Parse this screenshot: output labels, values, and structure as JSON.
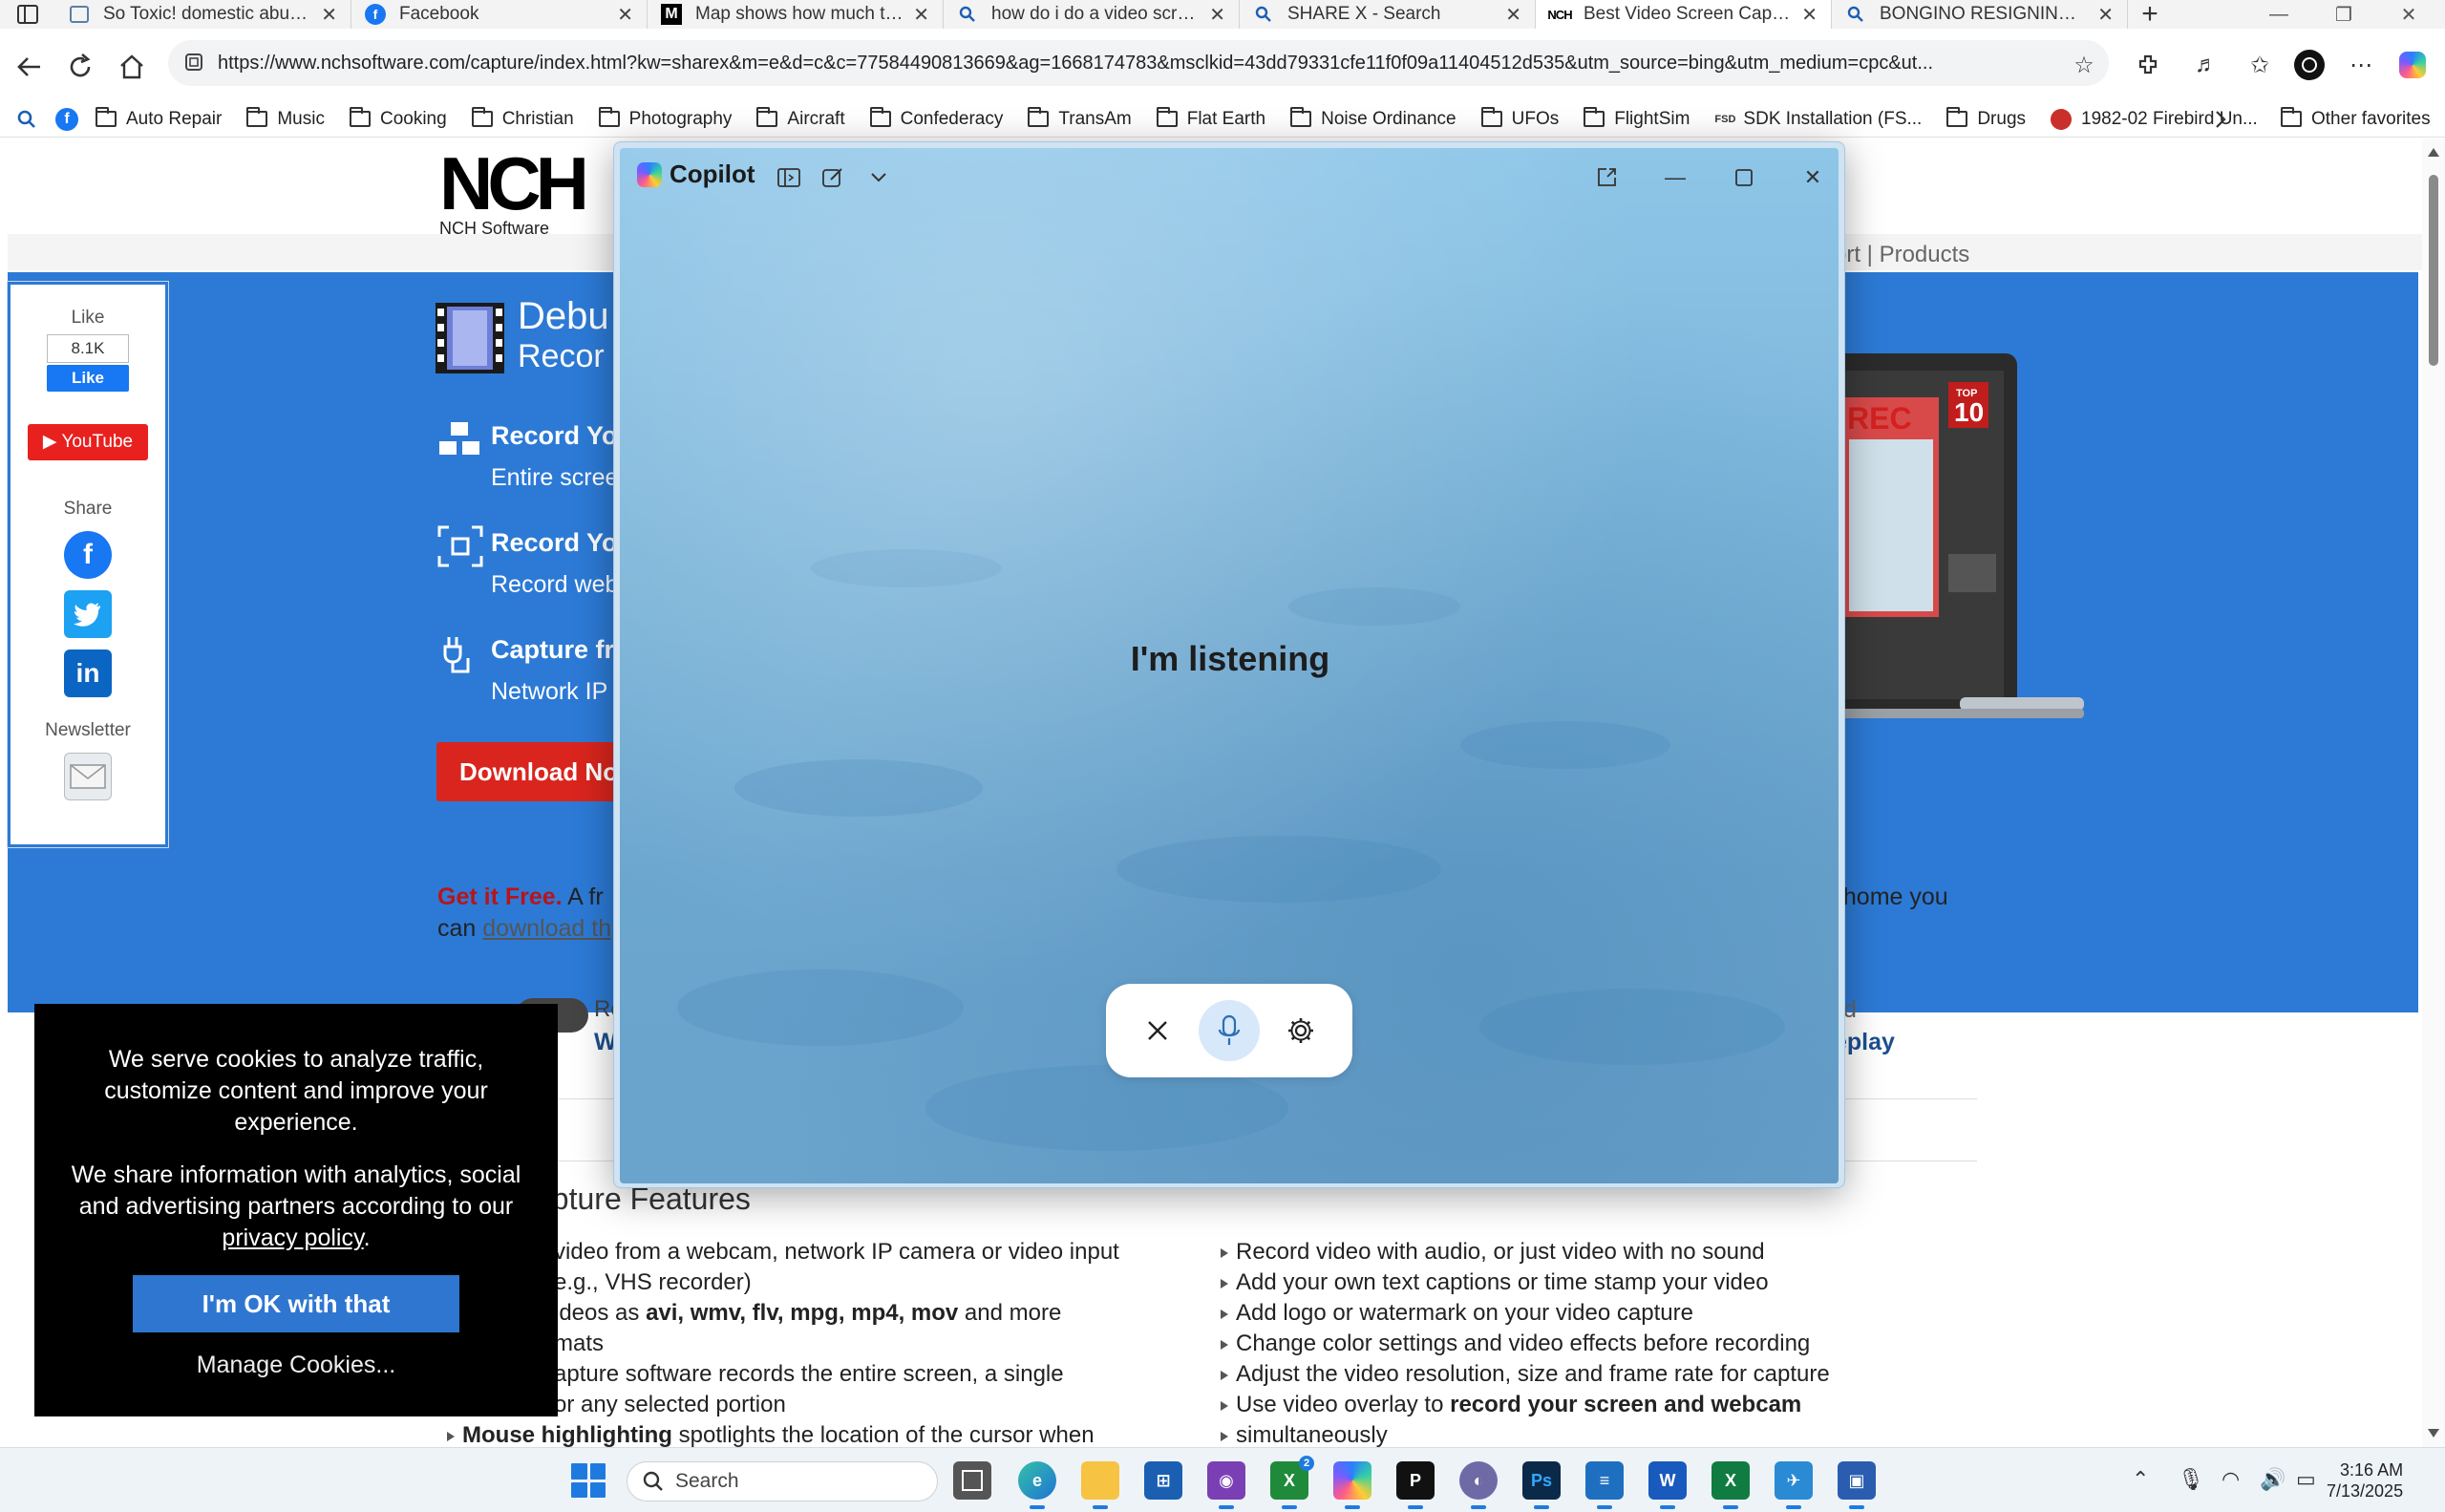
{
  "browser": {
    "tabs": [
      {
        "title": "So Toxic! domestic abuse and",
        "icon": "page-icon",
        "active": false
      },
      {
        "title": "Facebook",
        "icon": "facebook-icon",
        "active": false
      },
      {
        "title": "Map shows how much territ",
        "icon": "m-logo-icon",
        "active": false
      },
      {
        "title": "how do i do a video screen",
        "icon": "search-icon",
        "active": false
      },
      {
        "title": "SHARE X - Search",
        "icon": "search-icon",
        "active": false
      },
      {
        "title": "Best Video Screen Capture",
        "icon": "nch-icon",
        "active": true
      },
      {
        "title": "BONGINO RESIGNING - Se",
        "icon": "search-icon",
        "active": false
      }
    ],
    "url": "https://www.nchsoftware.com/capture/index.html?kw=sharex&m=e&d=c&c=77584490813669&ag=1668174783&msclkid=43dd79331cfe11f0f09a11404512d535&utm_source=bing&utm_medium=cpc&ut...",
    "favorites": [
      "Auto Repair",
      "Music",
      "Cooking",
      "Christian",
      "Photography",
      "Aircraft",
      "Confederacy",
      "TransAm",
      "Flat Earth",
      "Noise Ordinance",
      "UFOs",
      "FlightSim",
      "SDK Installation (FS...",
      "Drugs",
      "1982-02 Firebird Un..."
    ],
    "other_favorites": "Other favorites"
  },
  "page": {
    "logo_sub": "NCH Software",
    "logo_letters": "NCH",
    "nav_fragment": "ort | Products",
    "social": {
      "like_label": "Like",
      "like_count": "8.1K",
      "like_button": "Like",
      "youtube": "YouTube",
      "share_label": "Share",
      "newsletter_label": "Newsletter"
    },
    "hero_title_1": "Debu",
    "hero_title_2": "Recor",
    "features": [
      {
        "heading": "Record Yo",
        "sub": "Entire scree"
      },
      {
        "heading": "Record Yo",
        "sub": "Record web"
      },
      {
        "heading": "Capture fr",
        "sub": "Network IP"
      }
    ],
    "download_button": "Download No",
    "laptop_badge_top": "TOP",
    "laptop_badge_num": "10",
    "laptop_rec": "REC",
    "get_free_bold": "Get it Free.",
    "get_free_text": " A fr",
    "get_free_line2": "can ",
    "get_free_link": "download th",
    "right_fragment": "t home you",
    "row_left": "Re",
    "row_left_bold": "W",
    "right_d": "d",
    "right_bold": "eplay",
    "section_title": "apture Features",
    "left_bullets": [
      "video from a webcam, network IP camera or video input",
      "e.g., VHS recorder)"
    ],
    "left_formats_prefix": "ideos as ",
    "left_formats_bold": "avi, wmv, flv, mpg, mp4, mov",
    "left_formats_suffix": " and more",
    "left_formats_line2": "mats",
    "left_capture_1": "apture software records the entire screen, a single",
    "left_capture_2": "or any selected portion",
    "mouse_bold": "Mouse highlighting",
    "mouse_text": " spotlights the location of the cursor when",
    "right_bullets": [
      "Record video with audio, or just video with no sound",
      "Add your own text captions or time stamp your video",
      "Add logo or watermark on your video capture",
      "Change color settings and video effects before recording",
      "Adjust the video resolution, size and frame rate for capture"
    ],
    "right_overlay_prefix": "Use video overlay to ",
    "right_overlay_bold": "record your screen and webcam",
    "right_overlay_line2": "simultaneously"
  },
  "cookie": {
    "p1": "We serve cookies to analyze traffic, customize content and improve your experience.",
    "p2_prefix": "We share information with analytics, social and advertising partners according to our ",
    "p2_link": "privacy policy",
    "p2_suffix": ".",
    "ok_button": "I'm OK with that",
    "manage": "Manage Cookies..."
  },
  "copilot": {
    "title": "Copilot",
    "status": "I'm listening"
  },
  "taskbar": {
    "search_placeholder": "Search",
    "time": "3:16 AM",
    "date": "7/13/2025",
    "xbox_badge": "2"
  }
}
